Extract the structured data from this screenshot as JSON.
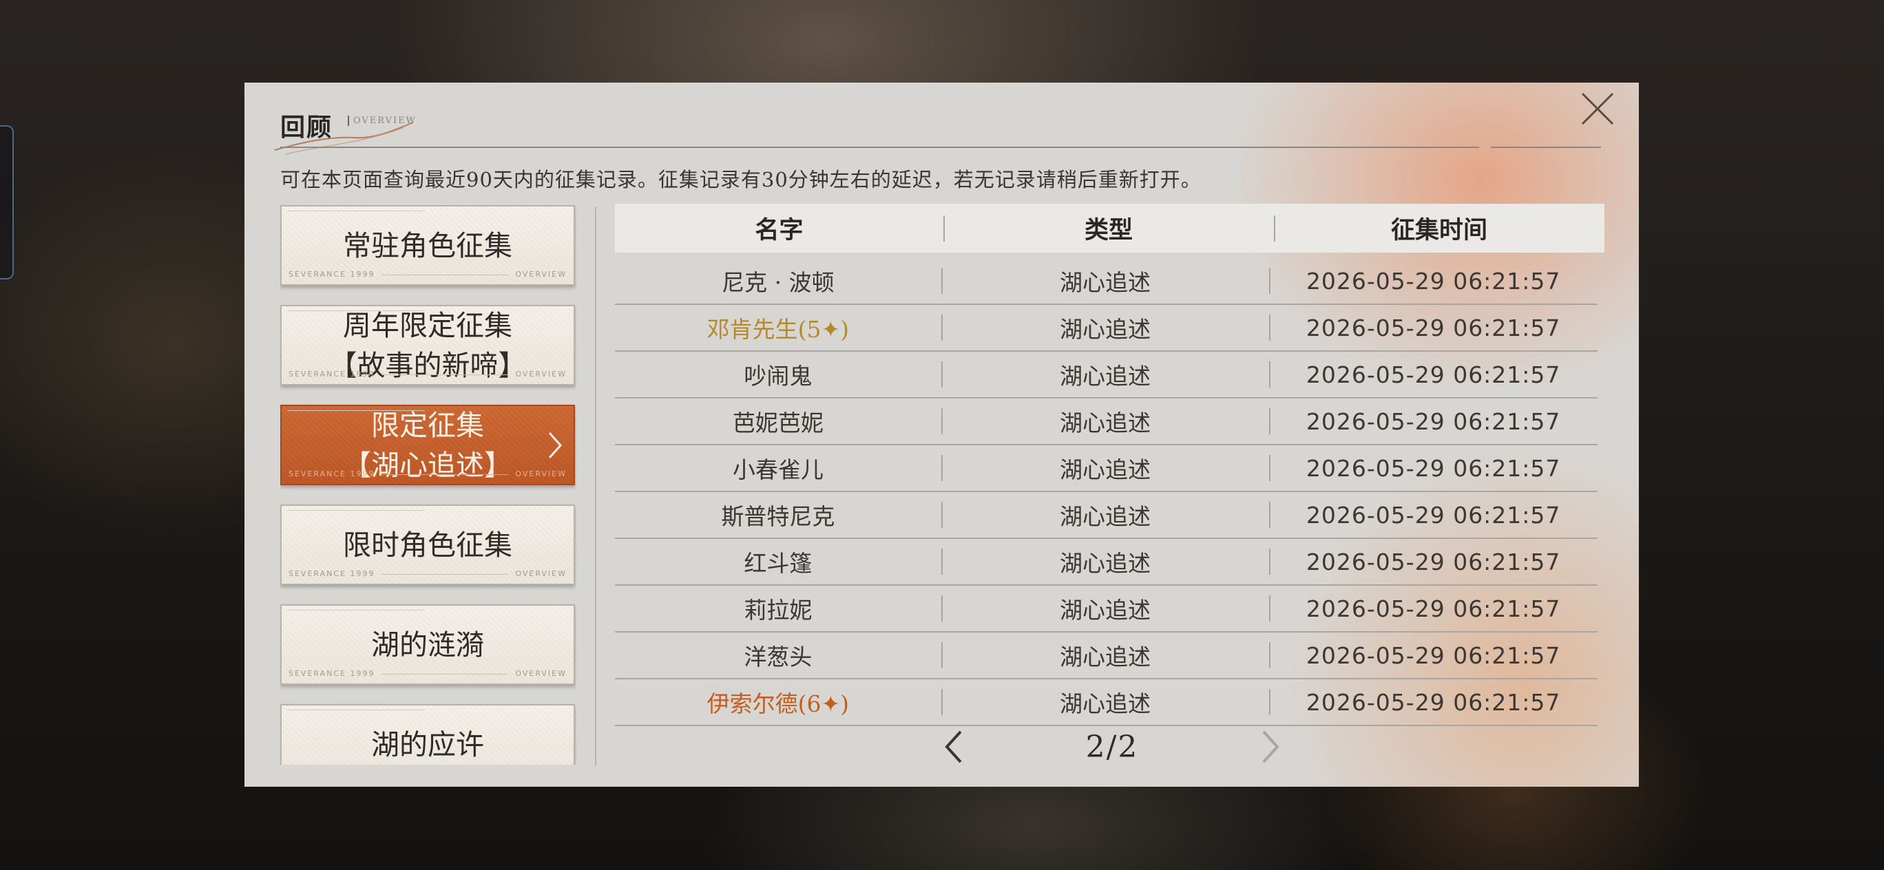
{
  "dialog": {
    "title": "回顾",
    "title_sub": "OVERVIEW",
    "notice": "可在本页面查询最近90天内的征集记录。征集记录有30分钟左右的延迟，若无记录请稍后重新打开。",
    "close_icon": "close-icon"
  },
  "sidebar": {
    "deco_left": "SEVERANCE 1999",
    "deco_right": "OVERVIEW",
    "items": [
      {
        "label": "常驻角色征集",
        "active": false
      },
      {
        "label": "周年限定征集\n【故事的新啼】",
        "active": false
      },
      {
        "label": "限定征集\n【湖心追述】",
        "active": true
      },
      {
        "label": "限时角色征集",
        "active": false
      },
      {
        "label": "湖的涟漪",
        "active": false
      },
      {
        "label": "湖的应许",
        "active": false
      }
    ]
  },
  "table": {
    "headers": {
      "name": "名字",
      "type": "类型",
      "time": "征集时间"
    },
    "rows": [
      {
        "name": "尼克 · 波顿",
        "type": "湖心追述",
        "time": "2026-05-29 06:21:57",
        "rarity": "normal"
      },
      {
        "name": "邓肯先生(5✦)",
        "type": "湖心追述",
        "time": "2026-05-29 06:21:57",
        "rarity": "gold"
      },
      {
        "name": "吵闹鬼",
        "type": "湖心追述",
        "time": "2026-05-29 06:21:57",
        "rarity": "normal"
      },
      {
        "name": "芭妮芭妮",
        "type": "湖心追述",
        "time": "2026-05-29 06:21:57",
        "rarity": "normal"
      },
      {
        "name": "小春雀儿",
        "type": "湖心追述",
        "time": "2026-05-29 06:21:57",
        "rarity": "normal"
      },
      {
        "name": "斯普特尼克",
        "type": "湖心追述",
        "time": "2026-05-29 06:21:57",
        "rarity": "normal"
      },
      {
        "name": "红斗篷",
        "type": "湖心追述",
        "time": "2026-05-29 06:21:57",
        "rarity": "normal"
      },
      {
        "name": "莉拉妮",
        "type": "湖心追述",
        "time": "2026-05-29 06:21:57",
        "rarity": "normal"
      },
      {
        "name": "洋葱头",
        "type": "湖心追述",
        "time": "2026-05-29 06:21:57",
        "rarity": "normal"
      },
      {
        "name": "伊索尔德(6✦)",
        "type": "湖心追述",
        "time": "2026-05-29 06:21:57",
        "rarity": "orange"
      }
    ]
  },
  "pager": {
    "page_label": "2/2",
    "prev_icon": "chevron-left-icon",
    "next_icon": "chevron-right-icon",
    "prev_enabled": true,
    "next_enabled": false
  },
  "colors": {
    "accent": "#c8612e",
    "gold_rarity": "#b48a28",
    "orange_rarity": "#c45e1c"
  }
}
